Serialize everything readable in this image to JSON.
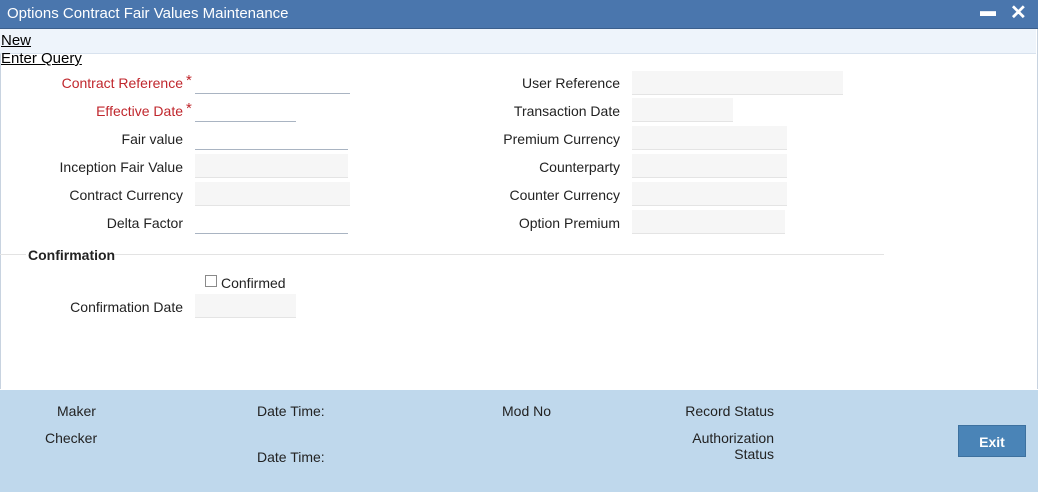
{
  "window": {
    "title": "Options Contract Fair Values Maintenance",
    "minimize_glyph": "▬",
    "close_glyph": "✕"
  },
  "menu": {
    "new_label": "New",
    "enter_query_label": "Enter Query"
  },
  "form": {
    "required_marker": "*",
    "contract_reference": {
      "label": "Contract Reference",
      "value": ""
    },
    "effective_date": {
      "label": "Effective Date",
      "value": ""
    },
    "fair_value": {
      "label": "Fair value",
      "value": ""
    },
    "inception_fair_value": {
      "label": "Inception Fair Value",
      "value": ""
    },
    "contract_currency": {
      "label": "Contract Currency",
      "value": ""
    },
    "delta_factor": {
      "label": "Delta Factor",
      "value": ""
    },
    "user_reference": {
      "label": "User Reference",
      "value": ""
    },
    "transaction_date": {
      "label": "Transaction Date",
      "value": ""
    },
    "premium_currency": {
      "label": "Premium Currency",
      "value": ""
    },
    "counterparty": {
      "label": "Counterparty",
      "value": ""
    },
    "counter_currency": {
      "label": "Counter Currency",
      "value": ""
    },
    "option_premium": {
      "label": "Option Premium",
      "value": ""
    }
  },
  "confirmation": {
    "section_title": "Confirmation",
    "confirmed_label": "Confirmed",
    "confirmed_checked": false,
    "confirmation_date_label": "Confirmation Date",
    "confirmation_date_value": ""
  },
  "footer": {
    "maker_label": "Maker",
    "checker_label": "Checker",
    "date_time_label_1": "Date Time:",
    "date_time_label_2": "Date Time:",
    "mod_no_label": "Mod No",
    "record_status_label": "Record Status",
    "authorization_label": "Authorization",
    "status_label": "Status",
    "exit_label": "Exit"
  },
  "colors": {
    "title_bar": "#4a76ad",
    "required_label": "#c0272d",
    "footer_bg": "#bfd8ec",
    "exit_button": "#4a84b7"
  }
}
